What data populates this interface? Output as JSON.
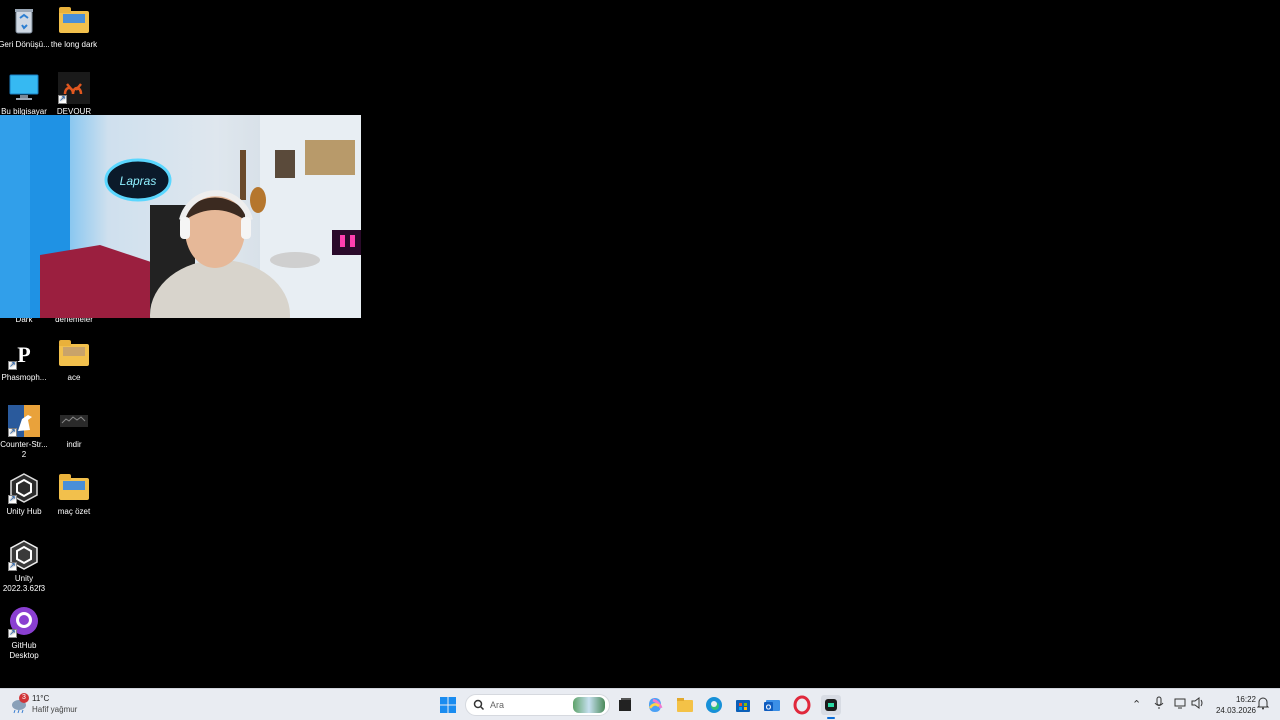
{
  "desktop": {
    "icons": [
      {
        "label": "Geri Dönüşü...",
        "icon": "recycle-bin-icon"
      },
      {
        "label": "the long dark",
        "icon": "folder-icon"
      },
      {
        "label": "Bu bilgisayar",
        "icon": "computer-icon"
      },
      {
        "label": "DEVOUR",
        "icon": "devour-icon"
      },
      {
        "label": "Dark",
        "icon": "game-icon"
      },
      {
        "label": "denemeler",
        "icon": "folder-icon"
      },
      {
        "label": "Phasmoph...",
        "icon": "phasmophobia-icon"
      },
      {
        "label": "ace",
        "icon": "folder-icon"
      },
      {
        "label": "Counter-Str... 2",
        "icon": "counter-strike-icon"
      },
      {
        "label": "indir",
        "icon": "image-file-icon"
      },
      {
        "label": "Unity Hub",
        "icon": "unity-hub-icon"
      },
      {
        "label": "maç özet",
        "icon": "folder-icon"
      },
      {
        "label": "Unity 2022.3.62f3",
        "icon": "unity-icon"
      },
      {
        "label": "GitHub Desktop",
        "icon": "github-icon"
      }
    ]
  },
  "webcam": {
    "neon_sign": "Lapras"
  },
  "taskbar": {
    "weather": {
      "temp": "11°C",
      "condition": "Hafif yağmur",
      "badge": "3"
    },
    "search_placeholder": "Ara",
    "clock": {
      "time": "16:22",
      "date": "24.03.2026"
    }
  }
}
